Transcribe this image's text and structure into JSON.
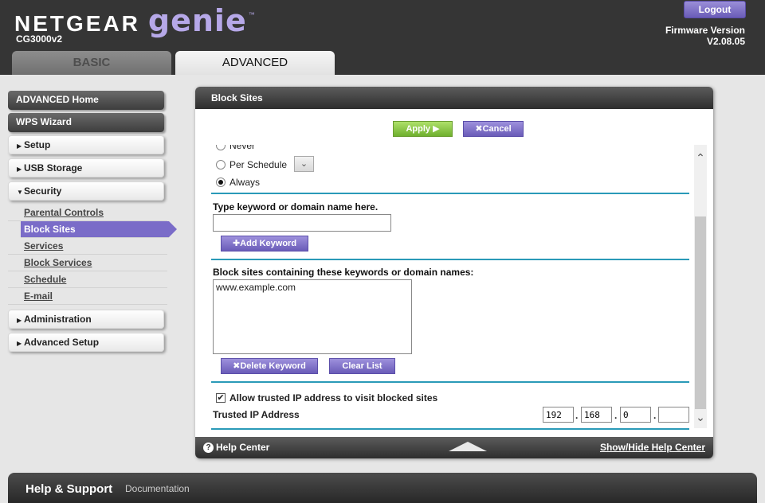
{
  "header": {
    "brand_name": "NETGEAR",
    "brand_product": "genie",
    "brand_tm": "™",
    "model": "CG3000v2",
    "logout_label": "Logout",
    "firmware_label": "Firmware Version",
    "firmware_version": "V2.08.05",
    "tabs": [
      {
        "label": "BASIC",
        "active": false
      },
      {
        "label": "ADVANCED",
        "active": true
      }
    ]
  },
  "sidebar": {
    "top_items": [
      {
        "label": "ADVANCED Home"
      },
      {
        "label": "WPS Wizard"
      }
    ],
    "groups": [
      {
        "label": "Setup",
        "expanded": false
      },
      {
        "label": "USB Storage",
        "expanded": false
      },
      {
        "label": "Security",
        "expanded": true
      }
    ],
    "security_items": [
      {
        "label": "Parental Controls",
        "active": false
      },
      {
        "label": "Block Sites",
        "active": true
      },
      {
        "label": "Services",
        "active": false
      },
      {
        "label": "Block Services",
        "active": false
      },
      {
        "label": "Schedule",
        "active": false
      },
      {
        "label": "E-mail",
        "active": false
      }
    ],
    "bottom_groups": [
      {
        "label": "Administration"
      },
      {
        "label": "Advanced Setup"
      }
    ]
  },
  "panel": {
    "title": "Block Sites",
    "apply_label": "Apply",
    "cancel_label": "Cancel",
    "radio_never": "Never",
    "radio_schedule": "Per Schedule",
    "radio_always": "Always",
    "selected_mode": "Always",
    "keyword_prompt": "Type keyword or domain name here.",
    "keyword_input_value": "",
    "add_keyword_label": "Add Keyword",
    "list_label": "Block sites containing these keywords or domain names:",
    "blocked_list": [
      "www.example.com"
    ],
    "delete_keyword_label": "Delete Keyword",
    "clear_list_label": "Clear List",
    "trusted_checkbox_label": "Allow trusted IP address to visit blocked sites",
    "trusted_checked": true,
    "trusted_ip_label": "Trusted IP Address",
    "trusted_ip": [
      "192",
      "168",
      "0",
      ""
    ],
    "ip_separator": "."
  },
  "help_bar": {
    "help_center_label": "Help Center",
    "toggle_label": "Show/Hide Help Center"
  },
  "footer": {
    "title": "Help & Support",
    "doc_link": "Documentation"
  },
  "colors": {
    "accent_purple": "#7a6cc8",
    "apply_green": "#6fb02e",
    "separator_teal": "#2a9ab8",
    "header_dark": "#353535"
  }
}
